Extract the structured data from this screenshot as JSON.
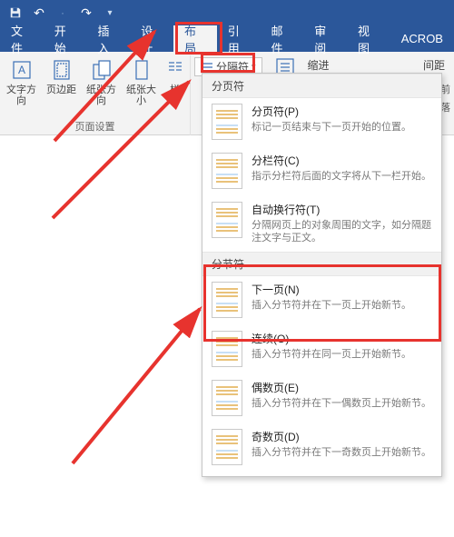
{
  "titlebar": {
    "save": "保存",
    "undo": "撤销",
    "redo": "重做"
  },
  "tabs": {
    "file": "文件",
    "home": "开始",
    "insert": "插入",
    "design": "设计",
    "layout": "布局",
    "references": "引用",
    "mailings": "邮件",
    "review": "审阅",
    "view": "视图",
    "acrobat": "ACROB"
  },
  "ribbon": {
    "text_direction": "文字方向",
    "margins": "页边距",
    "orientation": "纸张方向",
    "size": "纸张大小",
    "columns": "栏",
    "page_setup_group": "页面设置",
    "breaks_btn": "分隔符",
    "line_numbers": "缩进",
    "spacing": "间距",
    "before": "段前",
    "after": "段落"
  },
  "menu": {
    "section_page": "分页符",
    "section_section": "分节符",
    "items": [
      {
        "title": "分页符(P)",
        "desc": "标记一页结束与下一页开始的位置。"
      },
      {
        "title": "分栏符(C)",
        "desc": "指示分栏符后面的文字将从下一栏开始。"
      },
      {
        "title": "自动换行符(T)",
        "desc": "分隔网页上的对象周围的文字，如分隔题注文字与正文。"
      },
      {
        "title": "下一页(N)",
        "desc": "插入分节符并在下一页上开始新节。"
      },
      {
        "title": "连续(O)",
        "desc": "插入分节符并在同一页上开始新节。"
      },
      {
        "title": "偶数页(E)",
        "desc": "插入分节符并在下一偶数页上开始新节。"
      },
      {
        "title": "奇数页(D)",
        "desc": "插入分节符并在下一奇数页上开始新节。"
      }
    ]
  }
}
